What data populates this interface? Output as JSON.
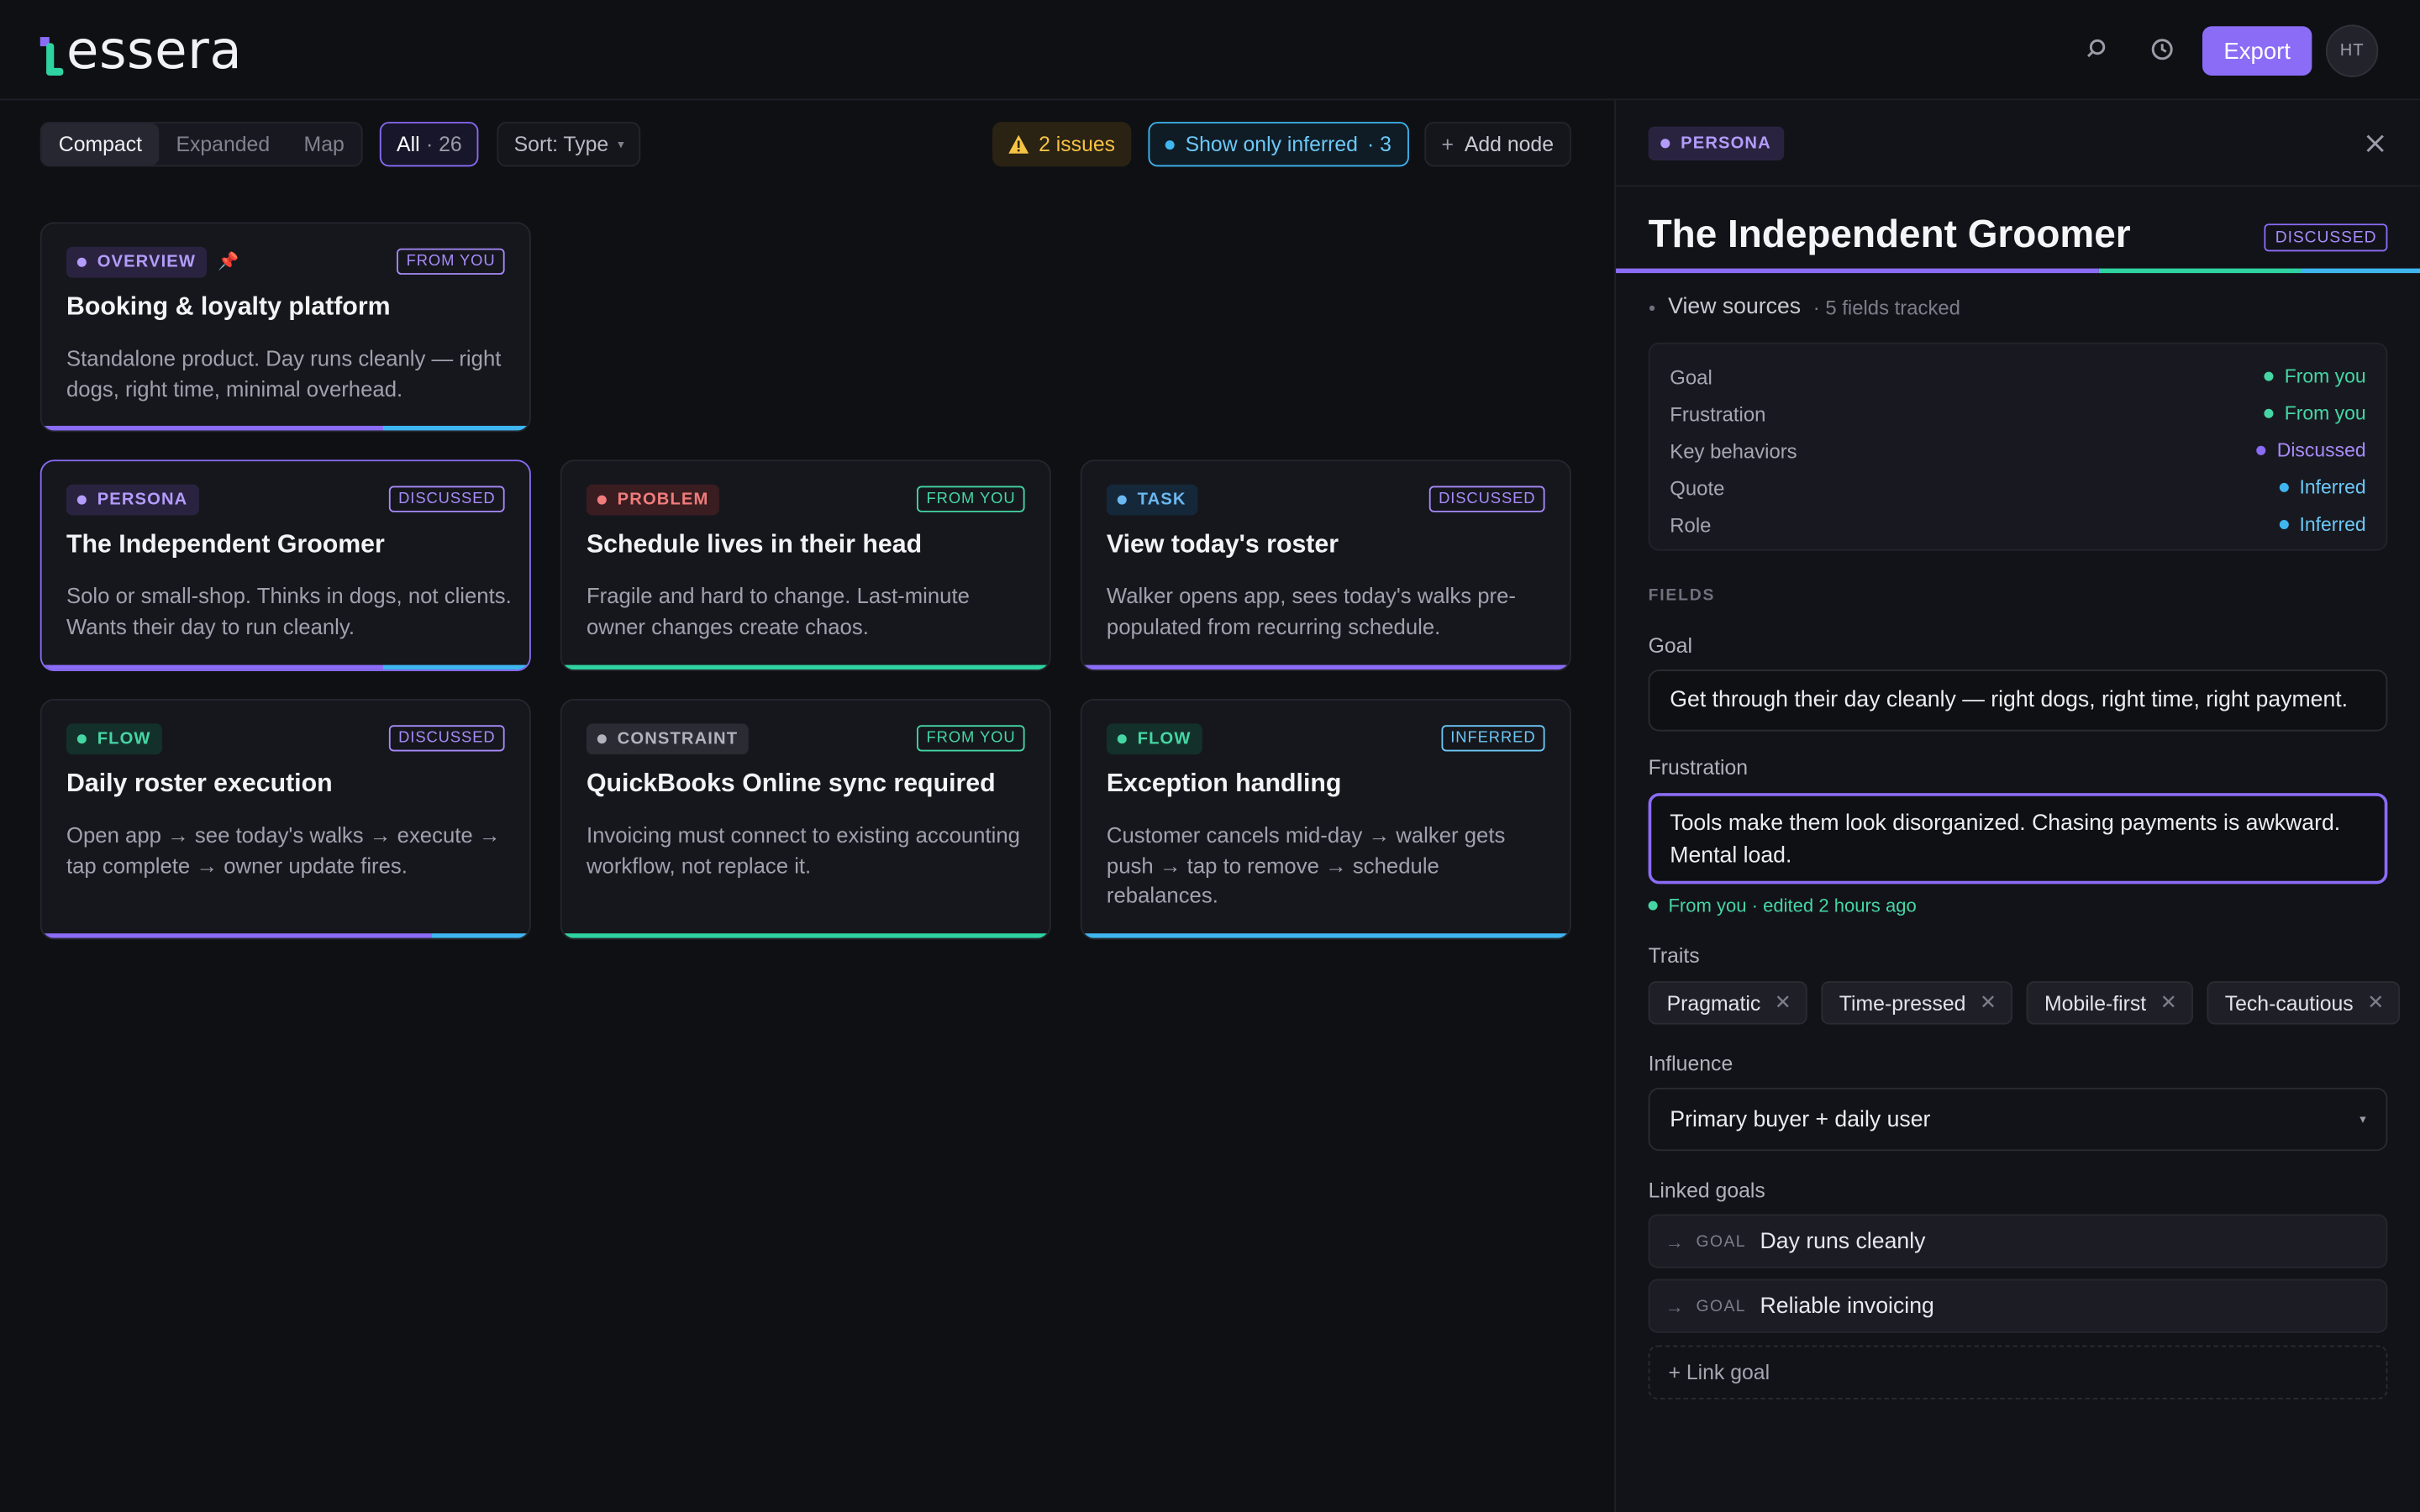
{
  "app": {
    "logo": "essera"
  },
  "header": {
    "export_label": "Export",
    "avatar_initials": "HT",
    "search_icon": "search-icon",
    "history_icon": "history-icon"
  },
  "toolbar": {
    "views": [
      "Compact",
      "Expanded",
      "Map"
    ],
    "active_view": "Compact",
    "filter_all_label": "All",
    "filter_all_count": "· 26",
    "sort_label": "Sort: Type",
    "issues_label": "2 issues",
    "inferred_label": "Show only inferred",
    "inferred_count": "· 3",
    "add_node_label": "Add node"
  },
  "colors": {
    "accent": "#8b6cf6",
    "from_you": "#45d6a4",
    "discussed": "#a78bfa",
    "inferred": "#6cc8f6",
    "warning": "#f6c344"
  },
  "cards": [
    {
      "tag": "OVERVIEW",
      "badge": "FROM YOU",
      "title": "Booking & loyalty platform",
      "desc": "Standalone product. Day runs cleanly — right dogs, right time, minimal overhead."
    },
    {
      "tag": "PERSONA",
      "badge": "DISCUSSED",
      "title": "The Independent Groomer",
      "desc": "Solo or small-shop. Thinks in dogs, not clients. Wants their day to run cleanly."
    },
    {
      "tag": "PROBLEM",
      "badge": "FROM YOU",
      "title": "Schedule lives in their head",
      "desc": "Fragile and hard to change. Last-minute owner changes create chaos."
    },
    {
      "tag": "TASK",
      "badge": "DISCUSSED",
      "title": "View today's roster",
      "desc": "Walker opens app, sees today's walks pre-populated from recurring schedule."
    },
    {
      "tag": "FLOW",
      "badge": "DISCUSSED",
      "title": "Daily roster execution",
      "desc": "Open app → see today's walks → execute → tap complete → owner update fires."
    },
    {
      "tag": "CONSTRAINT",
      "badge": "FROM YOU",
      "title": "QuickBooks Online sync required",
      "desc": "Invoicing must connect to existing accounting workflow, not replace it."
    },
    {
      "tag": "FLOW",
      "badge": "INFERRED",
      "title": "Exception handling",
      "desc": "Customer cancels mid-day → walker gets push → tap to remove → schedule rebalances."
    }
  ],
  "panel": {
    "tag": "PERSONA",
    "title": "The Independent Groomer",
    "badge": "DISCUSSED",
    "view_sources": "View sources",
    "fields_tracked": "· 5 fields tracked",
    "sources": [
      {
        "field": "Goal",
        "status": "From you"
      },
      {
        "field": "Frustration",
        "status": "From you"
      },
      {
        "field": "Key behaviors",
        "status": "Discussed"
      },
      {
        "field": "Quote",
        "status": "Inferred"
      },
      {
        "field": "Role",
        "status": "Inferred"
      }
    ],
    "fields_label": "FIELDS",
    "goal_label": "Goal",
    "goal_value": "Get through their day cleanly — right dogs, right time, right payment.",
    "frustration_label": "Frustration",
    "frustration_value": "Tools make them look disorganized. Chasing payments is awkward. Mental load.",
    "edited_note": "From you · edited 2 hours ago",
    "traits_label": "Traits",
    "traits": [
      "Pragmatic",
      "Time-pressed",
      "Mobile-first",
      "Tech-cautious"
    ],
    "influence_label": "Influence",
    "influence_value": "Primary buyer + daily user",
    "linked_goals_label": "Linked goals",
    "linked_goals": [
      {
        "kind": "GOAL",
        "name": "Day runs cleanly"
      },
      {
        "kind": "GOAL",
        "name": "Reliable invoicing"
      }
    ],
    "link_goal_label": "+ Link goal"
  }
}
